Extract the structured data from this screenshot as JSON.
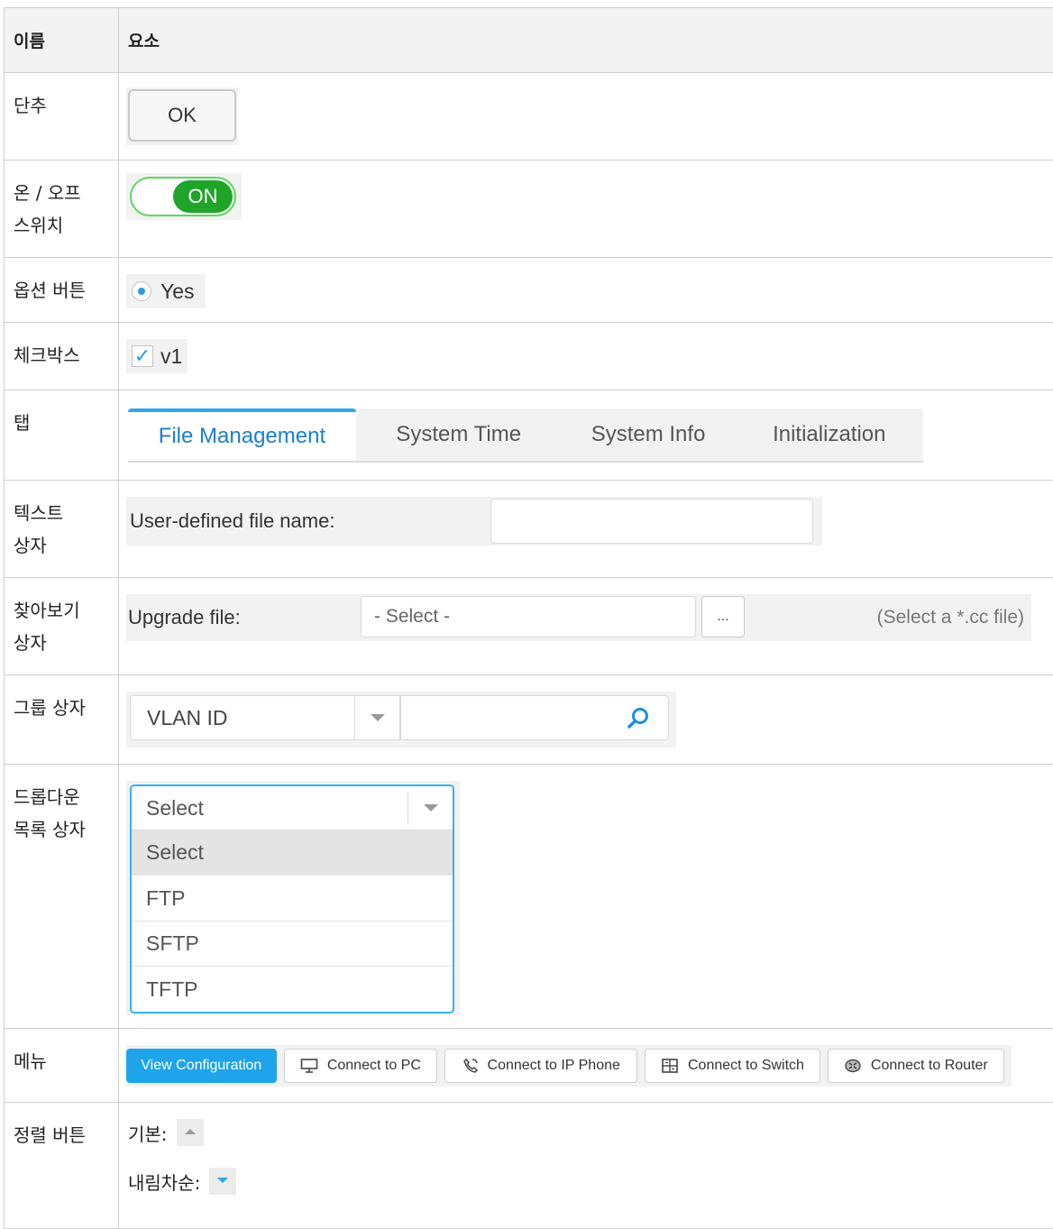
{
  "header": {
    "col_name": "이름",
    "col_element": "요소"
  },
  "rows": {
    "button": {
      "name": "단추",
      "ok_label": "OK"
    },
    "switch": {
      "name_line1": "온 / 오프",
      "name_line2": "스위치",
      "state": "ON"
    },
    "radio": {
      "name": "옵션 버튼",
      "label": "Yes"
    },
    "checkbox": {
      "name": "체크박스",
      "label": "v1"
    },
    "tabs": {
      "name": "탭",
      "items": [
        "File Management",
        "System Time",
        "System Info",
        "Initialization"
      ],
      "active": "File Management"
    },
    "textbox": {
      "name_line1": "텍스트",
      "name_line2": "상자",
      "label": "User-defined file name:",
      "value": ""
    },
    "browse": {
      "name_line1": "찾아보기",
      "name_line2": "상자",
      "label": "Upgrade file:",
      "select_text": "- Select -",
      "button": "...",
      "hint": "(Select a *.cc file)"
    },
    "group": {
      "name": "그룹 상자",
      "select": "VLAN ID",
      "value": ""
    },
    "dropdown": {
      "name_line1": "드롭다운",
      "name_line2": "목록 상자",
      "selected": "Select",
      "options": [
        "Select",
        "FTP",
        "SFTP",
        "TFTP"
      ]
    },
    "menu": {
      "name": "메뉴",
      "items": [
        "View Configuration",
        "Connect to PC",
        "Connect to IP Phone",
        "Connect to Switch",
        "Connect to Router"
      ]
    },
    "sort": {
      "name": "정렬 버튼",
      "default_label": "기본:",
      "descending_label": "내림차순:"
    }
  },
  "colors": {
    "accent": "#1ea4ea",
    "switch_on": "#1fa52a",
    "tab_active": "#1a7fd1"
  }
}
